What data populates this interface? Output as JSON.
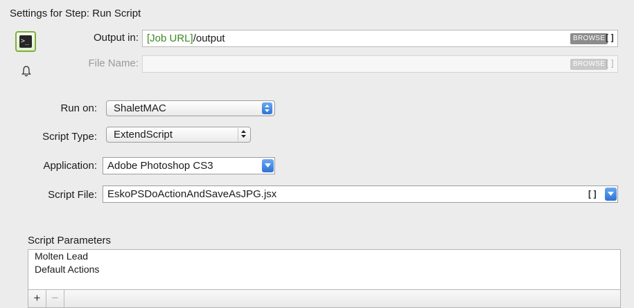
{
  "header": {
    "title": "Settings for Step: Run Script"
  },
  "step_icon": {
    "glyph": ">_",
    "icon": "terminal-icon",
    "accent_color": "#7ab03c"
  },
  "output": {
    "label": "Output in:",
    "token": "[Job URL]",
    "value_suffix": "/output",
    "browse_label": "BROWSE",
    "brackets": "[]"
  },
  "file_name": {
    "label": "File Name:",
    "value": "",
    "browse_label": "BROWSE",
    "brackets": "[]"
  },
  "run_on": {
    "label": "Run on:",
    "value": "ShaletMAC"
  },
  "script_type": {
    "label": "Script Type:",
    "value": "ExtendScript"
  },
  "application": {
    "label": "Application:",
    "value": "Adobe Photoshop CS3"
  },
  "script_file": {
    "label": "Script File:",
    "value": "EskoPSDoActionAndSaveAsJPG.jsx",
    "brackets": "[]"
  },
  "params": {
    "label": "Script Parameters",
    "items": [
      "Molten Lead",
      "Default Actions"
    ],
    "add_label": "+",
    "remove_label": "−"
  }
}
